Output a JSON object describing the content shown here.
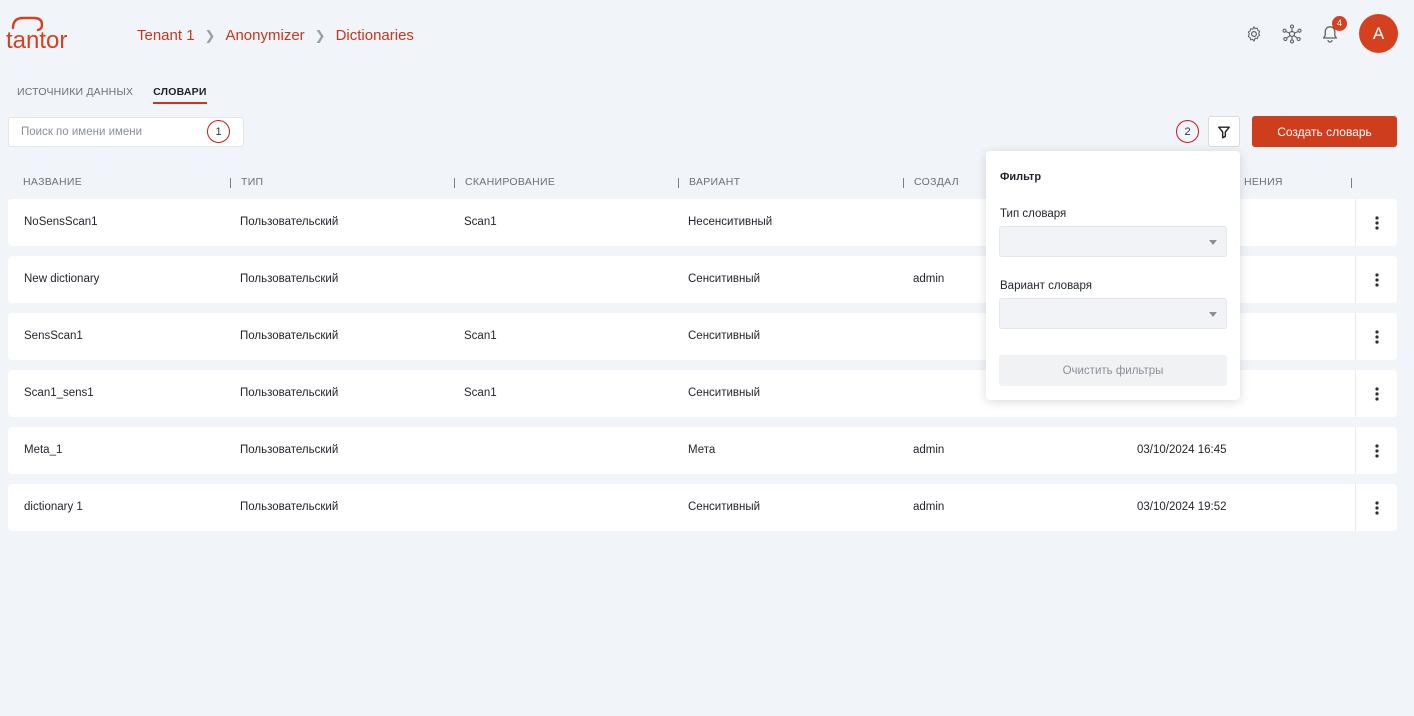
{
  "brand": {
    "logo_text": "tantor",
    "accent": "#d5411f"
  },
  "breadcrumb": [
    "Tenant 1",
    "Anonymizer",
    "Dictionaries"
  ],
  "header": {
    "notifications_count": "4",
    "avatar_letter": "A",
    "icons": [
      "gear-icon",
      "network-icon",
      "bell-icon"
    ]
  },
  "tabs": [
    {
      "label": "ИСТОЧНИКИ ДАННЫХ",
      "active": false
    },
    {
      "label": "СЛОВАРИ",
      "active": true
    }
  ],
  "search": {
    "placeholder": "Поиск по имени имени",
    "value": ""
  },
  "markers": [
    "1",
    "2"
  ],
  "toolbar": {
    "create_label": "Создать словарь"
  },
  "table": {
    "columns": [
      "НАЗВАНИЕ",
      "ТИП",
      "СКАНИРОВАНИЕ",
      "ВАРИАНТ",
      "СОЗДАЛ",
      "НЕНИЯ"
    ],
    "rows": [
      {
        "name": "NoSensScan1",
        "type": "Пользовательский",
        "scan": "Scan1",
        "variant": "Несенситивный",
        "created_by": "",
        "date": ""
      },
      {
        "name": "New dictionary",
        "type": "Пользовательский",
        "scan": "",
        "variant": "Сенситивный",
        "created_by": "admin",
        "date": ""
      },
      {
        "name": "SensScan1",
        "type": "Пользовательский",
        "scan": "Scan1",
        "variant": "Сенситивный",
        "created_by": "",
        "date": ""
      },
      {
        "name": "Scan1_sens1",
        "type": "Пользовательский",
        "scan": "Scan1",
        "variant": "Сенситивный",
        "created_by": "",
        "date": ""
      },
      {
        "name": "Meta_1",
        "type": "Пользовательский",
        "scan": "",
        "variant": "Мета",
        "created_by": "admin",
        "date": "03/10/2024 16:45"
      },
      {
        "name": "dictionary 1",
        "type": "Пользовательский",
        "scan": "",
        "variant": "Сенситивный",
        "created_by": "admin",
        "date": "03/10/2024 19:52"
      }
    ]
  },
  "filter_popup": {
    "title": "Фильтр",
    "dictionary_type_label": "Тип словаря",
    "dictionary_type_value": "",
    "dictionary_variant_label": "Вариант словаря",
    "dictionary_variant_value": "",
    "clear_label": "Очистить фильтры"
  }
}
